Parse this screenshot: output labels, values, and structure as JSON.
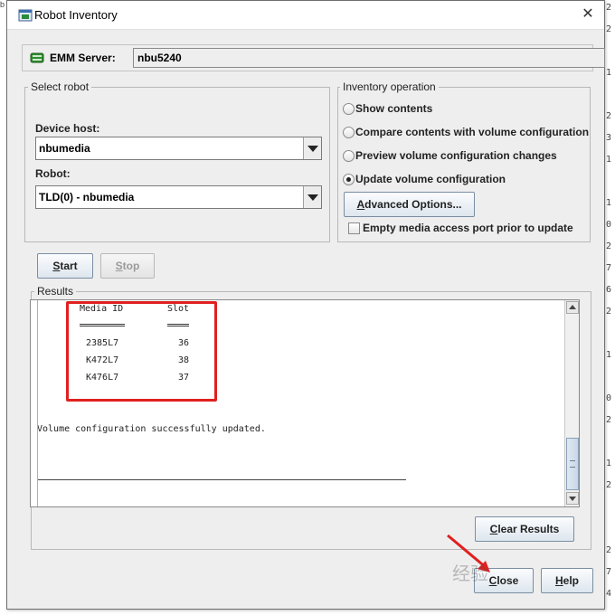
{
  "window": {
    "title": "Robot Inventory"
  },
  "emm": {
    "label": "EMM Server:",
    "value": "nbu5240"
  },
  "select_robot": {
    "legend": "Select robot",
    "device_host_label": "Device host:",
    "device_host_value": "nbumedia",
    "robot_label": "Robot:",
    "robot_value": "TLD(0) - nbumedia"
  },
  "inventory_operation": {
    "legend": "Inventory operation",
    "options": [
      {
        "label": "Show contents",
        "selected": false
      },
      {
        "label": "Compare contents with volume configuration",
        "selected": false
      },
      {
        "label": "Preview volume configuration changes",
        "selected": false
      },
      {
        "label": "Update volume configuration",
        "selected": true
      }
    ],
    "advanced_button": "Advanced Options...",
    "empty_port_label": "Empty media access port prior to update",
    "empty_port_checked": false
  },
  "actions": {
    "start": "Start",
    "stop": "Stop"
  },
  "results": {
    "legend": "Results",
    "header_media": "Media ID",
    "header_slot": "Slot",
    "rows": [
      {
        "media": "2385L7",
        "slot": "36"
      },
      {
        "media": "K472L7",
        "slot": "38"
      },
      {
        "media": "K476L7",
        "slot": "37"
      }
    ],
    "message": "Volume configuration successfully updated.",
    "clear_button": "Clear Results"
  },
  "footer": {
    "close": "Close",
    "help": "Help"
  },
  "background_fragments": {
    "top": "b",
    "right": [
      "2",
      "2",
      "",
      "1",
      "",
      "2",
      "3",
      "1",
      "",
      "1",
      "0",
      "2",
      "7",
      "6",
      "2",
      "",
      "1",
      "",
      "0",
      "2",
      "",
      "1",
      "2",
      "",
      "",
      "2",
      "7",
      "4"
    ]
  },
  "watermark": "经验",
  "colors": {
    "highlight_box": "#e02020",
    "window_bg": "#eeeeee",
    "button_border": "#7a8ea3"
  }
}
